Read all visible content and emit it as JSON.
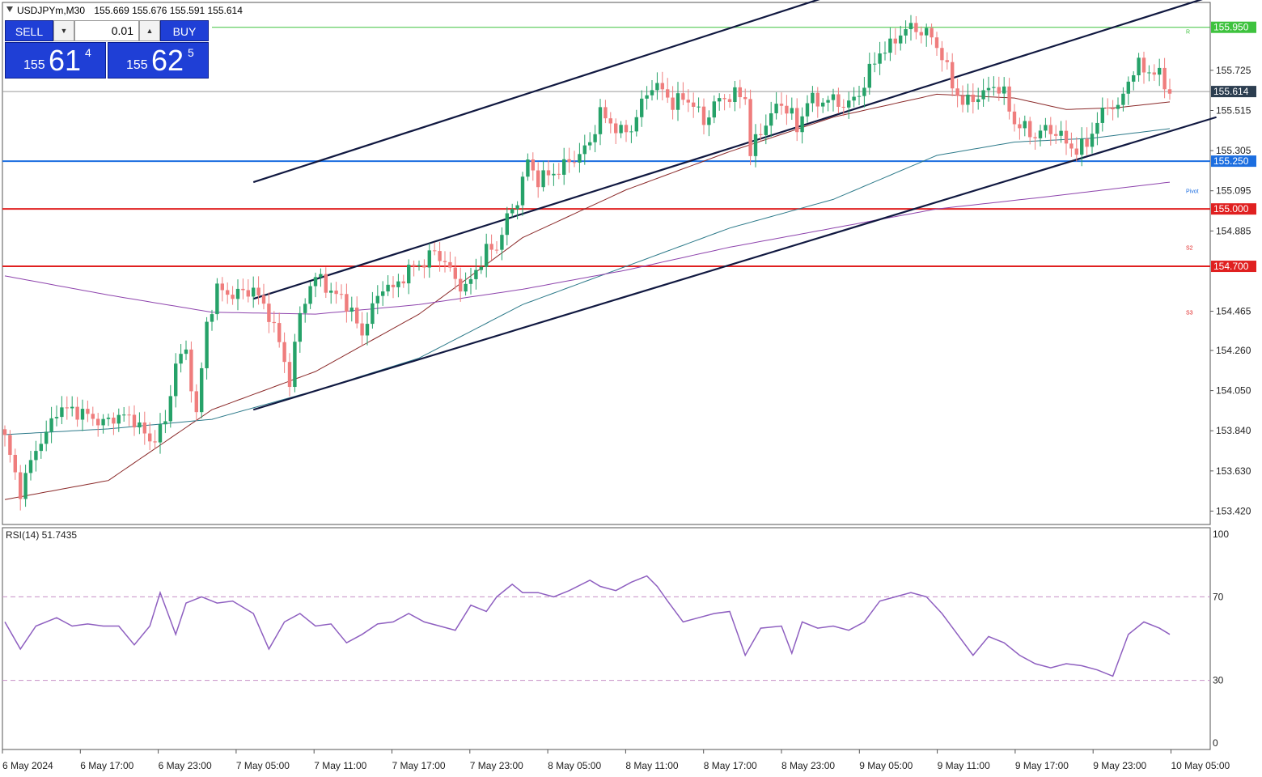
{
  "header": {
    "symbol": "USDJPYm,M30",
    "ohlc": "155.669 155.676 155.591 155.614"
  },
  "trade_panel": {
    "sell_label": "SELL",
    "buy_label": "BUY",
    "lot": "0.01",
    "sell_price": {
      "prefix": "155",
      "big": "61",
      "sup": "4"
    },
    "buy_price": {
      "prefix": "155",
      "big": "62",
      "sup": "5"
    }
  },
  "colors": {
    "bull": "#26a269",
    "bear": "#ef7d7d",
    "channel": "#101840",
    "ma_fast": "#8b2a2a",
    "ma_mid": "#2d7a8a",
    "ma_slow": "#8e44ad",
    "resistance": "#3ec23e",
    "support_blue": "#1c6ee0",
    "support_red": "#e02020",
    "rsi": "#8e5fc0",
    "rsi_level": "#c890c8"
  },
  "price_axis": {
    "ticks": [
      "155.725",
      "155.515",
      "155.305",
      "155.095",
      "154.885",
      "154.465",
      "154.260",
      "154.050",
      "153.840",
      "153.630",
      "153.420"
    ],
    "current_price": "155.614",
    "levels": [
      {
        "id": "r",
        "value": 155.95,
        "label": "155.950",
        "color": "#3ec23e",
        "width": 1
      },
      {
        "id": "b",
        "value": 155.25,
        "label": "155.250",
        "color": "#1c6ee0",
        "width": 2
      },
      {
        "id": "r1",
        "value": 155.0,
        "label": "155.000",
        "color": "#e02020",
        "width": 2
      },
      {
        "id": "r2",
        "value": 154.7,
        "label": "154.700",
        "color": "#e02020",
        "width": 2
      }
    ],
    "pivot_labels": [
      {
        "text": "R",
        "value": 155.93,
        "color": "#3ec23e"
      },
      {
        "text": "Pivot",
        "value": 155.095,
        "color": "#1c6ee0"
      },
      {
        "text": "S2",
        "value": 154.8,
        "color": "#e02020"
      },
      {
        "text": "S3",
        "value": 154.46,
        "color": "#e02020"
      }
    ]
  },
  "rsi": {
    "label": "RSI(14) 51.7435",
    "ticks": [
      "100",
      "70",
      "30",
      "0"
    ]
  },
  "time_axis": [
    "6 May 2024",
    "6 May 17:00",
    "6 May 23:00",
    "7 May 05:00",
    "7 May 11:00",
    "7 May 17:00",
    "7 May 23:00",
    "8 May 05:00",
    "8 May 11:00",
    "8 May 17:00",
    "8 May 23:00",
    "9 May 05:00",
    "9 May 11:00",
    "9 May 17:00",
    "9 May 23:00",
    "10 May 05:00"
  ],
  "chart_data": {
    "type": "candlestick",
    "symbol": "USDJPYm",
    "timeframe": "M30",
    "ylim": [
      153.35,
      156.08
    ],
    "candle_anchors": [
      {
        "i": 0,
        "c": 153.8
      },
      {
        "i": 3,
        "c": 153.52
      },
      {
        "i": 6,
        "c": 153.75
      },
      {
        "i": 8,
        "c": 153.82
      },
      {
        "i": 10,
        "c": 153.95
      },
      {
        "i": 13,
        "c": 153.95
      },
      {
        "i": 16,
        "c": 153.92
      },
      {
        "i": 19,
        "c": 153.88
      },
      {
        "i": 22,
        "c": 153.92
      },
      {
        "i": 25,
        "c": 153.9
      },
      {
        "i": 28,
        "c": 153.78
      },
      {
        "i": 31,
        "c": 153.88
      },
      {
        "i": 33,
        "c": 154.2
      },
      {
        "i": 35,
        "c": 154.25
      },
      {
        "i": 37,
        "c": 153.92
      },
      {
        "i": 39,
        "c": 154.4
      },
      {
        "i": 41,
        "c": 154.58
      },
      {
        "i": 44,
        "c": 154.55
      },
      {
        "i": 48,
        "c": 154.58
      },
      {
        "i": 51,
        "c": 154.45
      },
      {
        "i": 53,
        "c": 154.3
      },
      {
        "i": 55,
        "c": 154.1
      },
      {
        "i": 57,
        "c": 154.45
      },
      {
        "i": 59,
        "c": 154.6
      },
      {
        "i": 61,
        "c": 154.65
      },
      {
        "i": 63,
        "c": 154.55
      },
      {
        "i": 65,
        "c": 154.55
      },
      {
        "i": 67,
        "c": 154.45
      },
      {
        "i": 69,
        "c": 154.35
      },
      {
        "i": 71,
        "c": 154.48
      },
      {
        "i": 73,
        "c": 154.6
      },
      {
        "i": 75,
        "c": 154.58
      },
      {
        "i": 77,
        "c": 154.65
      },
      {
        "i": 79,
        "c": 154.7
      },
      {
        "i": 81,
        "c": 154.72
      },
      {
        "i": 83,
        "c": 154.78
      },
      {
        "i": 85,
        "c": 154.72
      },
      {
        "i": 87,
        "c": 154.63
      },
      {
        "i": 89,
        "c": 154.58
      },
      {
        "i": 91,
        "c": 154.68
      },
      {
        "i": 93,
        "c": 154.78
      },
      {
        "i": 95,
        "c": 154.8
      },
      {
        "i": 97,
        "c": 154.95
      },
      {
        "i": 99,
        "c": 155.05
      },
      {
        "i": 101,
        "c": 155.25
      },
      {
        "i": 103,
        "c": 155.15
      },
      {
        "i": 105,
        "c": 155.18
      },
      {
        "i": 107,
        "c": 155.2
      },
      {
        "i": 109,
        "c": 155.25
      },
      {
        "i": 111,
        "c": 155.28
      },
      {
        "i": 113,
        "c": 155.35
      },
      {
        "i": 115,
        "c": 155.5
      },
      {
        "i": 117,
        "c": 155.45
      },
      {
        "i": 119,
        "c": 155.4
      },
      {
        "i": 121,
        "c": 155.42
      },
      {
        "i": 123,
        "c": 155.55
      },
      {
        "i": 125,
        "c": 155.65
      },
      {
        "i": 127,
        "c": 155.62
      },
      {
        "i": 129,
        "c": 155.55
      },
      {
        "i": 131,
        "c": 155.58
      },
      {
        "i": 133,
        "c": 155.55
      },
      {
        "i": 135,
        "c": 155.45
      },
      {
        "i": 137,
        "c": 155.55
      },
      {
        "i": 139,
        "c": 155.58
      },
      {
        "i": 141,
        "c": 155.6
      },
      {
        "i": 143,
        "c": 155.58
      },
      {
        "i": 144,
        "c": 155.3
      },
      {
        "i": 146,
        "c": 155.4
      },
      {
        "i": 148,
        "c": 155.5
      },
      {
        "i": 150,
        "c": 155.55
      },
      {
        "i": 152,
        "c": 155.5
      },
      {
        "i": 153,
        "c": 155.4
      },
      {
        "i": 155,
        "c": 155.58
      },
      {
        "i": 157,
        "c": 155.55
      },
      {
        "i": 159,
        "c": 155.58
      },
      {
        "i": 161,
        "c": 155.55
      },
      {
        "i": 163,
        "c": 155.55
      },
      {
        "i": 165,
        "c": 155.6
      },
      {
        "i": 167,
        "c": 155.72
      },
      {
        "i": 169,
        "c": 155.82
      },
      {
        "i": 171,
        "c": 155.85
      },
      {
        "i": 173,
        "c": 155.92
      },
      {
        "i": 175,
        "c": 155.95
      },
      {
        "i": 177,
        "c": 155.93
      },
      {
        "i": 179,
        "c": 155.9
      },
      {
        "i": 181,
        "c": 155.8
      },
      {
        "i": 183,
        "c": 155.65
      },
      {
        "i": 185,
        "c": 155.55
      },
      {
        "i": 187,
        "c": 155.58
      },
      {
        "i": 189,
        "c": 155.6
      },
      {
        "i": 191,
        "c": 155.65
      },
      {
        "i": 193,
        "c": 155.6
      },
      {
        "i": 195,
        "c": 155.45
      },
      {
        "i": 197,
        "c": 155.42
      },
      {
        "i": 199,
        "c": 155.38
      },
      {
        "i": 201,
        "c": 155.42
      },
      {
        "i": 203,
        "c": 155.4
      },
      {
        "i": 205,
        "c": 155.35
      },
      {
        "i": 207,
        "c": 155.3
      },
      {
        "i": 209,
        "c": 155.35
      },
      {
        "i": 211,
        "c": 155.45
      },
      {
        "i": 213,
        "c": 155.55
      },
      {
        "i": 215,
        "c": 155.52
      },
      {
        "i": 217,
        "c": 155.68
      },
      {
        "i": 219,
        "c": 155.75
      },
      {
        "i": 221,
        "c": 155.72
      },
      {
        "i": 223,
        "c": 155.7
      },
      {
        "i": 225,
        "c": 155.61
      }
    ],
    "ma_fast": [
      {
        "i": 0,
        "v": 153.48
      },
      {
        "i": 20,
        "v": 153.58
      },
      {
        "i": 40,
        "v": 153.95
      },
      {
        "i": 60,
        "v": 154.15
      },
      {
        "i": 80,
        "v": 154.45
      },
      {
        "i": 100,
        "v": 154.85
      },
      {
        "i": 120,
        "v": 155.1
      },
      {
        "i": 140,
        "v": 155.3
      },
      {
        "i": 160,
        "v": 155.48
      },
      {
        "i": 180,
        "v": 155.6
      },
      {
        "i": 195,
        "v": 155.58
      },
      {
        "i": 205,
        "v": 155.52
      },
      {
        "i": 215,
        "v": 155.53
      },
      {
        "i": 225,
        "v": 155.56
      }
    ],
    "ma_mid": [
      {
        "i": 0,
        "v": 153.82
      },
      {
        "i": 20,
        "v": 153.85
      },
      {
        "i": 40,
        "v": 153.9
      },
      {
        "i": 60,
        "v": 154.05
      },
      {
        "i": 80,
        "v": 154.22
      },
      {
        "i": 100,
        "v": 154.5
      },
      {
        "i": 120,
        "v": 154.7
      },
      {
        "i": 140,
        "v": 154.9
      },
      {
        "i": 160,
        "v": 155.05
      },
      {
        "i": 180,
        "v": 155.28
      },
      {
        "i": 195,
        "v": 155.35
      },
      {
        "i": 210,
        "v": 155.37
      },
      {
        "i": 225,
        "v": 155.42
      }
    ],
    "ma_slow": [
      {
        "i": 0,
        "v": 154.65
      },
      {
        "i": 20,
        "v": 154.55
      },
      {
        "i": 40,
        "v": 154.46
      },
      {
        "i": 60,
        "v": 154.45
      },
      {
        "i": 80,
        "v": 154.5
      },
      {
        "i": 100,
        "v": 154.58
      },
      {
        "i": 120,
        "v": 154.68
      },
      {
        "i": 140,
        "v": 154.8
      },
      {
        "i": 160,
        "v": 154.9
      },
      {
        "i": 180,
        "v": 155.0
      },
      {
        "i": 200,
        "v": 155.06
      },
      {
        "i": 225,
        "v": 155.14
      }
    ],
    "channel_lines": [
      {
        "i1": 48,
        "v1": 155.14,
        "i2": 160,
        "v2": 156.12
      },
      {
        "i1": 48,
        "v1": 154.53,
        "i2": 234,
        "v2": 156.12
      },
      {
        "i1": 48,
        "v1": 153.95,
        "i2": 234,
        "v2": 155.48
      }
    ],
    "rsi_ylim": [
      0,
      100
    ],
    "rsi_levels": [
      70,
      30
    ],
    "rsi": [
      {
        "i": 0,
        "v": 58
      },
      {
        "i": 3,
        "v": 45
      },
      {
        "i": 6,
        "v": 56
      },
      {
        "i": 10,
        "v": 60
      },
      {
        "i": 13,
        "v": 56
      },
      {
        "i": 16,
        "v": 57
      },
      {
        "i": 19,
        "v": 56
      },
      {
        "i": 22,
        "v": 56
      },
      {
        "i": 25,
        "v": 47
      },
      {
        "i": 28,
        "v": 56
      },
      {
        "i": 30,
        "v": 72
      },
      {
        "i": 33,
        "v": 52
      },
      {
        "i": 35,
        "v": 67
      },
      {
        "i": 38,
        "v": 70
      },
      {
        "i": 41,
        "v": 67
      },
      {
        "i": 44,
        "v": 68
      },
      {
        "i": 48,
        "v": 62
      },
      {
        "i": 51,
        "v": 45
      },
      {
        "i": 54,
        "v": 58
      },
      {
        "i": 57,
        "v": 62
      },
      {
        "i": 60,
        "v": 56
      },
      {
        "i": 63,
        "v": 57
      },
      {
        "i": 66,
        "v": 48
      },
      {
        "i": 69,
        "v": 52
      },
      {
        "i": 72,
        "v": 57
      },
      {
        "i": 75,
        "v": 58
      },
      {
        "i": 78,
        "v": 62
      },
      {
        "i": 81,
        "v": 58
      },
      {
        "i": 84,
        "v": 56
      },
      {
        "i": 87,
        "v": 54
      },
      {
        "i": 90,
        "v": 66
      },
      {
        "i": 93,
        "v": 63
      },
      {
        "i": 95,
        "v": 70
      },
      {
        "i": 98,
        "v": 76
      },
      {
        "i": 100,
        "v": 72
      },
      {
        "i": 103,
        "v": 72
      },
      {
        "i": 106,
        "v": 70
      },
      {
        "i": 109,
        "v": 73
      },
      {
        "i": 113,
        "v": 78
      },
      {
        "i": 115,
        "v": 75
      },
      {
        "i": 118,
        "v": 73
      },
      {
        "i": 121,
        "v": 77
      },
      {
        "i": 124,
        "v": 80
      },
      {
        "i": 126,
        "v": 75
      },
      {
        "i": 128,
        "v": 68
      },
      {
        "i": 131,
        "v": 58
      },
      {
        "i": 134,
        "v": 60
      },
      {
        "i": 137,
        "v": 62
      },
      {
        "i": 140,
        "v": 63
      },
      {
        "i": 143,
        "v": 42
      },
      {
        "i": 146,
        "v": 55
      },
      {
        "i": 150,
        "v": 56
      },
      {
        "i": 152,
        "v": 43
      },
      {
        "i": 154,
        "v": 58
      },
      {
        "i": 157,
        "v": 55
      },
      {
        "i": 160,
        "v": 56
      },
      {
        "i": 163,
        "v": 54
      },
      {
        "i": 166,
        "v": 58
      },
      {
        "i": 169,
        "v": 68
      },
      {
        "i": 172,
        "v": 70
      },
      {
        "i": 175,
        "v": 72
      },
      {
        "i": 178,
        "v": 70
      },
      {
        "i": 181,
        "v": 62
      },
      {
        "i": 184,
        "v": 52
      },
      {
        "i": 187,
        "v": 42
      },
      {
        "i": 190,
        "v": 51
      },
      {
        "i": 193,
        "v": 48
      },
      {
        "i": 196,
        "v": 42
      },
      {
        "i": 199,
        "v": 38
      },
      {
        "i": 202,
        "v": 36
      },
      {
        "i": 205,
        "v": 38
      },
      {
        "i": 208,
        "v": 37
      },
      {
        "i": 211,
        "v": 35
      },
      {
        "i": 214,
        "v": 32
      },
      {
        "i": 217,
        "v": 52
      },
      {
        "i": 220,
        "v": 58
      },
      {
        "i": 223,
        "v": 55
      },
      {
        "i": 225,
        "v": 52
      }
    ]
  }
}
